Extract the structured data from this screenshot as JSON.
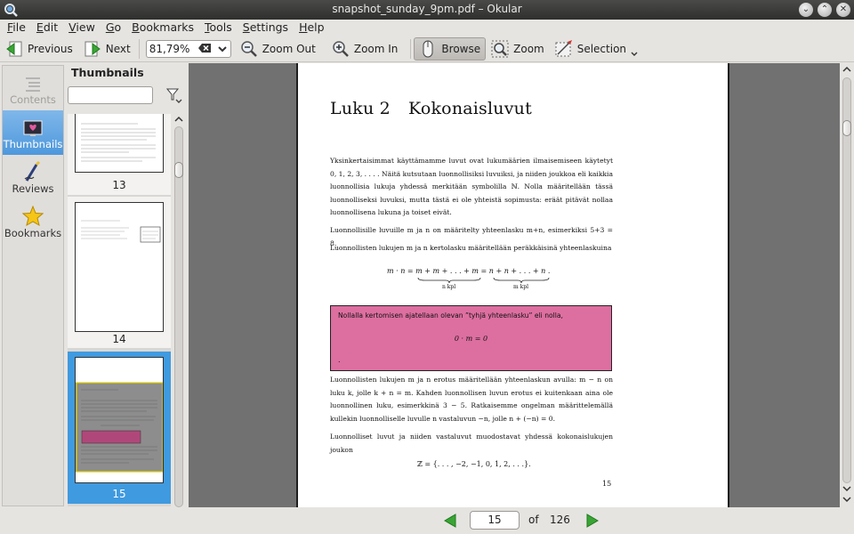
{
  "window": {
    "title": "snapshot_sunday_9pm.pdf – Okular",
    "buttons": {
      "minimize": "⌄",
      "restore": "⌃",
      "close": "✕"
    }
  },
  "menubar": {
    "items": [
      {
        "first": "F",
        "rest": "ile"
      },
      {
        "first": "E",
        "rest": "dit"
      },
      {
        "first": "V",
        "rest": "iew"
      },
      {
        "first": "G",
        "rest": "o"
      },
      {
        "first": "B",
        "rest": "ookmarks"
      },
      {
        "first": "T",
        "rest": "ools"
      },
      {
        "first": "S",
        "rest": "ettings"
      },
      {
        "first": "H",
        "rest": "elp"
      }
    ]
  },
  "toolbar": {
    "previous": "Previous",
    "next": "Next",
    "zoom_value": "81,79%",
    "zoom_out": "Zoom Out",
    "zoom_in": "Zoom In",
    "browse": "Browse",
    "zoom": "Zoom",
    "selection": "Selection"
  },
  "sidebar": {
    "tabs": [
      {
        "label": "Contents",
        "icon": "contents-icon",
        "state": "disabled"
      },
      {
        "label": "Thumbnails",
        "icon": "thumbnails-icon",
        "state": "active"
      },
      {
        "label": "Reviews",
        "icon": "reviews-icon",
        "state": "normal"
      },
      {
        "label": "Bookmarks",
        "icon": "bookmarks-icon",
        "state": "normal"
      }
    ]
  },
  "thumbnails": {
    "heading": "Thumbnails",
    "search_placeholder": "",
    "pages": [
      {
        "number": "13"
      },
      {
        "number": "14"
      },
      {
        "number": "15",
        "selected": true
      }
    ]
  },
  "document": {
    "chapter_number": "Luku 2",
    "chapter_title": "Kokonaisluvut",
    "para1": "Yksinkertaisimmat käyttämamme luvut ovat lukumäärien ilmaisemiseen käytetyt 0, 1, 2, 3, . . . . Näitä kutsutaan luonnollisiksi luvuiksi, ja niiden joukkoa eli kaikkia luonnollisia lukuja yhdessä merkitään symbolilla ℕ. Nolla määritellään tässä luonnolliseksi luvuksi, mutta tästä ei ole yhteistä sopimusta: eräät pitävät nollaa luonnollisena lukuna ja toiset eivät.",
    "para2": "Luonnollisille luvuille m ja n on määritelty yhteenlasku m+n, esimerkiksi 5+3 = 8.",
    "para3": "Luonnollisten lukujen m ja n kertolasku määritellään peräkkäisinä yhteenlaskuina",
    "formula1": "m · n = m + m + . . . + m = n + n + . . . + n .",
    "brace1": "n kpl",
    "brace2": "m kpl",
    "box_text": "Nollalla kertomisen ajatellaan olevan ”tyhjä yhteenlasku” eli nolla,",
    "box_formula": "0 · m = 0",
    "box_end": ".",
    "para4": "Luonnollisten lukujen m ja n erotus määritellään yhteenlaskun avulla: m − n on luku k, jolle k + n = m. Kahden luonnollisen luvun erotus ei kuitenkaan aina ole luonnollinen luku, esimerkkinä 3 − 5. Ratkaisemme ongelman määrittelemällä kullekin luonnolliselle luvulle n vastaluvun −n, jolle n + (−n) = 0.",
    "para5": "Luonnolliset luvut ja niiden vastaluvut muodostavat yhdessä kokonaislukujen joukon",
    "formula2": "ℤ = {. . . , −2, −1, 0, 1, 2, . . .}.",
    "page_number": "15"
  },
  "navigation": {
    "current_page": "15",
    "of_label": "of",
    "total_pages": "126"
  },
  "colors": {
    "accent": "#3f9ae0",
    "definition_box": "#dd6fa0",
    "nav_arrow": "#3aa535",
    "document_background": "#717171"
  }
}
